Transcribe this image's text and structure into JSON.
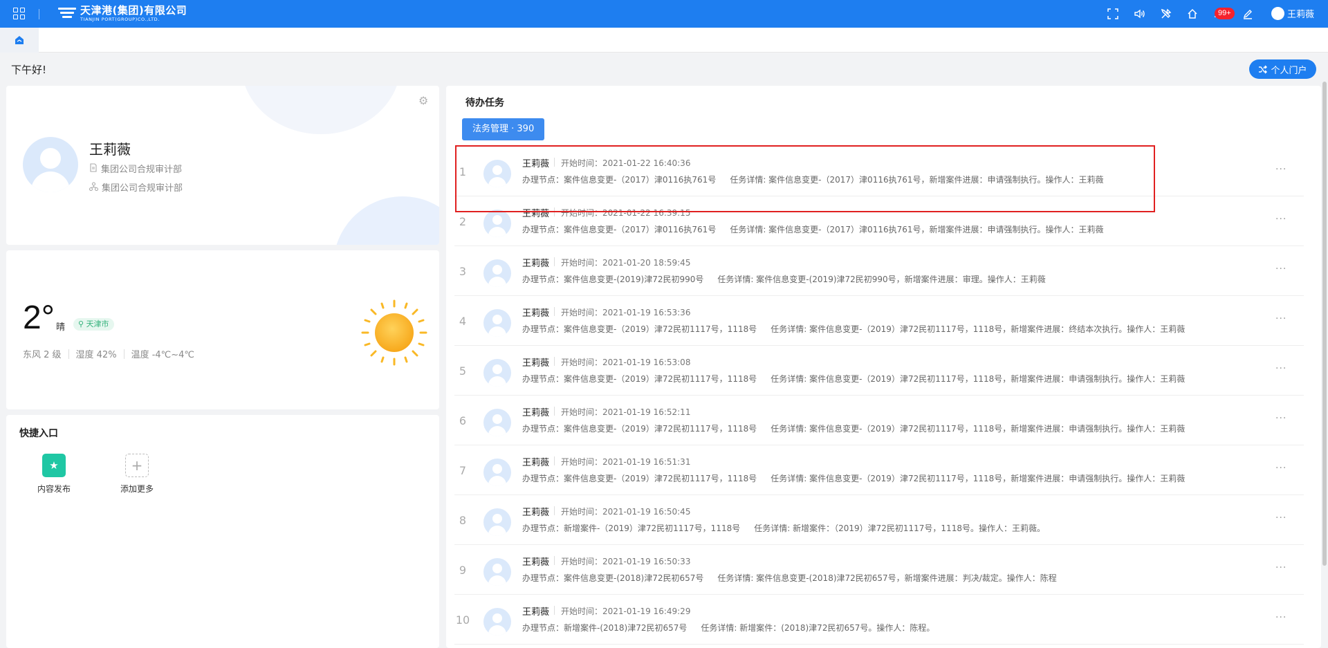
{
  "header": {
    "logo_cn": "天津港(集团)有限公司",
    "logo_en": "TIANJIN PORT(GROUP)CO.,LTD.",
    "notification_count": "99+",
    "user_name": "王莉薇",
    "accent_color": "#1e7ef0"
  },
  "greeting": "下午好!",
  "portal_button": "个人门户",
  "profile": {
    "name": "王莉薇",
    "department": "集团公司合规审计部",
    "organization": "集团公司合规审计部"
  },
  "weather": {
    "temperature": "2°",
    "condition": "晴",
    "city": "天津市",
    "wind": "东风 2 级",
    "humidity": "湿度 42%",
    "temp_range": "温度 -4℃~4℃"
  },
  "quick_entry": {
    "title": "快捷入口",
    "items": [
      {
        "label": "内容发布",
        "icon": "star-icon"
      },
      {
        "label": "添加更多",
        "icon": "plus-icon"
      }
    ]
  },
  "tasks": {
    "title": "待办任务",
    "tab_label": "法务管理 · 390",
    "rows": [
      {
        "num": "1",
        "name": "王莉薇",
        "time": "开始时间：2021-01-22 16:40:36",
        "node": "办理节点：案件信息变更-（2017）津0116执761号",
        "detail": "任务详情: 案件信息变更-（2017）津0116执761号，新增案件进展：申请强制执行。操作人：王莉薇"
      },
      {
        "num": "2",
        "name": "王莉薇",
        "time": "开始时间：2021-01-22 16:39:15",
        "node": "办理节点：案件信息变更-（2017）津0116执761号",
        "detail": "任务详情: 案件信息变更-（2017）津0116执761号，新增案件进展：申请强制执行。操作人：王莉薇"
      },
      {
        "num": "3",
        "name": "王莉薇",
        "time": "开始时间：2021-01-20 18:59:45",
        "node": "办理节点：案件信息变更-(2019)津72民初990号",
        "detail": "任务详情: 案件信息变更-(2019)津72民初990号，新增案件进展：审理。操作人：王莉薇"
      },
      {
        "num": "4",
        "name": "王莉薇",
        "time": "开始时间：2021-01-19 16:53:36",
        "node": "办理节点：案件信息变更-（2019）津72民初1117号，1118号",
        "detail": "任务详情: 案件信息变更-（2019）津72民初1117号，1118号，新增案件进展：终结本次执行。操作人：王莉薇"
      },
      {
        "num": "5",
        "name": "王莉薇",
        "time": "开始时间：2021-01-19 16:53:08",
        "node": "办理节点：案件信息变更-（2019）津72民初1117号，1118号",
        "detail": "任务详情: 案件信息变更-（2019）津72民初1117号，1118号，新增案件进展：申请强制执行。操作人：王莉薇"
      },
      {
        "num": "6",
        "name": "王莉薇",
        "time": "开始时间：2021-01-19 16:52:11",
        "node": "办理节点：案件信息变更-（2019）津72民初1117号，1118号",
        "detail": "任务详情: 案件信息变更-（2019）津72民初1117号，1118号，新增案件进展：申请强制执行。操作人：王莉薇"
      },
      {
        "num": "7",
        "name": "王莉薇",
        "time": "开始时间：2021-01-19 16:51:31",
        "node": "办理节点：案件信息变更-（2019）津72民初1117号，1118号",
        "detail": "任务详情: 案件信息变更-（2019）津72民初1117号，1118号，新增案件进展：申请强制执行。操作人：王莉薇"
      },
      {
        "num": "8",
        "name": "王莉薇",
        "time": "开始时间：2021-01-19 16:50:45",
        "node": "办理节点：新增案件-（2019）津72民初1117号，1118号",
        "detail": "任务详情: 新增案件：（2019）津72民初1117号，1118号。操作人：王莉薇。"
      },
      {
        "num": "9",
        "name": "王莉薇",
        "time": "开始时间：2021-01-19 16:50:33",
        "node": "办理节点：案件信息变更-(2018)津72民初657号",
        "detail": "任务详情: 案件信息变更-(2018)津72民初657号，新增案件进展：判决/裁定。操作人：陈程"
      },
      {
        "num": "10",
        "name": "王莉薇",
        "time": "开始时间：2021-01-19 16:49:29",
        "node": "办理节点：新增案件-(2018)津72民初657号",
        "detail": "任务详情: 新增案件：(2018)津72民初657号。操作人：陈程。"
      }
    ]
  }
}
